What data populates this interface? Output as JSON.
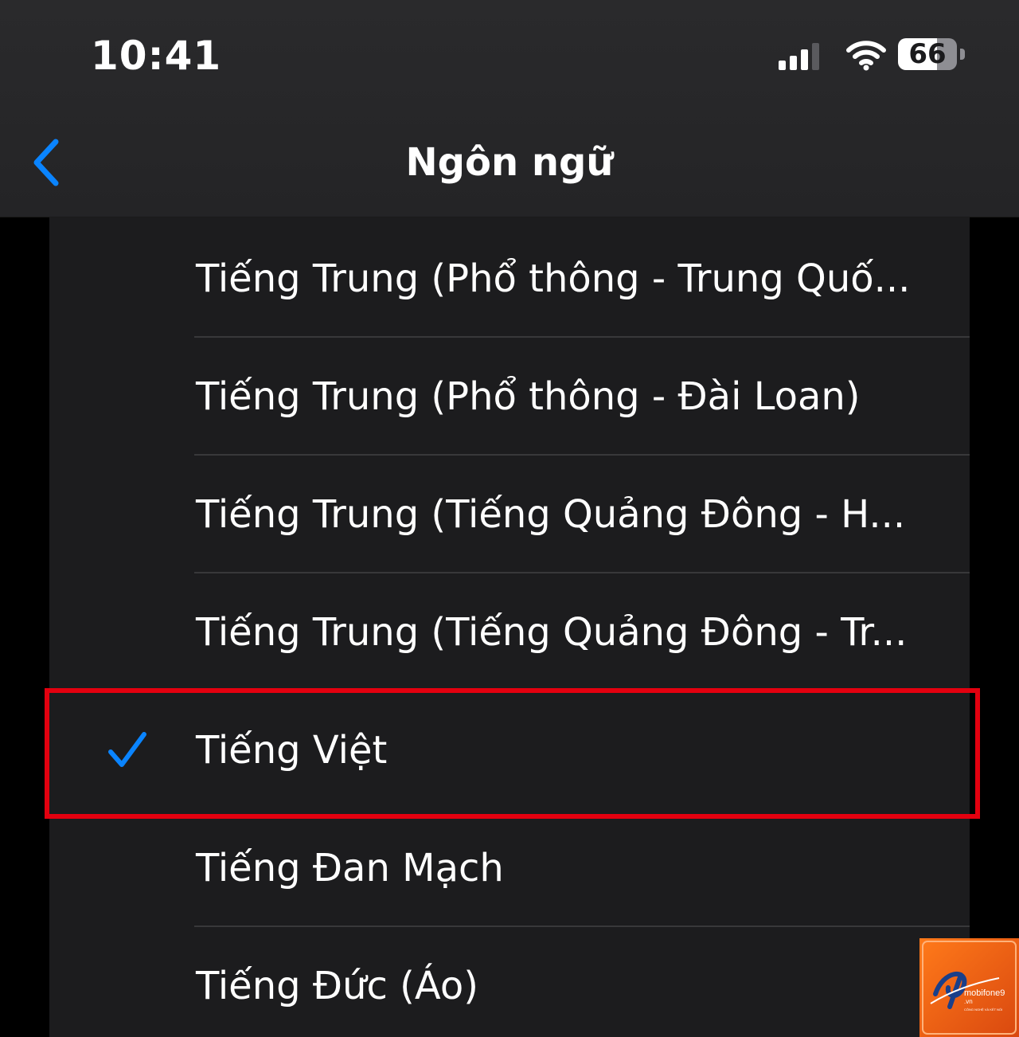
{
  "status_bar": {
    "time": "10:41",
    "battery_level": "66",
    "icons": [
      "signal-icon",
      "wifi-icon",
      "battery-icon"
    ]
  },
  "nav": {
    "title": "Ngôn ngữ",
    "back_icon": "chevron-left-icon"
  },
  "languages": [
    {
      "label": "Tiếng Trung (Phổ thông - Trung Quố...",
      "selected": false
    },
    {
      "label": "Tiếng Trung (Phổ thông - Đài Loan)",
      "selected": false
    },
    {
      "label": "Tiếng Trung (Tiếng Quảng Đông - H...",
      "selected": false
    },
    {
      "label": "Tiếng Trung (Tiếng Quảng Đông - Tr...",
      "selected": false
    },
    {
      "label": "Tiếng Việt",
      "selected": true
    },
    {
      "label": "Tiếng Đan Mạch",
      "selected": false
    },
    {
      "label": "Tiếng Đức (Áo)",
      "selected": false
    }
  ],
  "colors": {
    "accent": "#0a84ff",
    "highlight": "#e3000f",
    "background": "#000000",
    "list_background": "#1c1c1e"
  },
  "watermark": {
    "brand": "mobifone9",
    "domain": ".vn",
    "tagline": "CÔNG NGHỆ VÀ KẾT NỐI"
  }
}
